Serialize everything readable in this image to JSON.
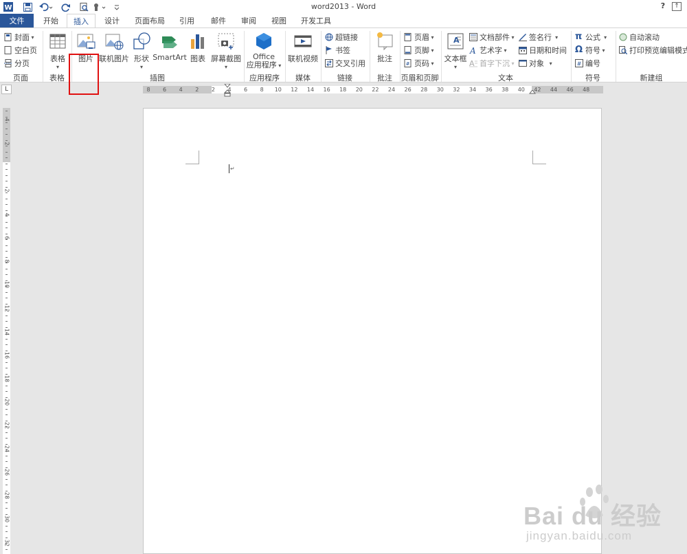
{
  "window": {
    "title": "word2013 - Word"
  },
  "quick_access": {
    "help": "?"
  },
  "tabs": [
    {
      "label": "文件",
      "id": "file"
    },
    {
      "label": "开始",
      "id": "home"
    },
    {
      "label": "插入",
      "id": "insert"
    },
    {
      "label": "设计",
      "id": "design"
    },
    {
      "label": "页面布局",
      "id": "layout"
    },
    {
      "label": "引用",
      "id": "references"
    },
    {
      "label": "邮件",
      "id": "mailings"
    },
    {
      "label": "审阅",
      "id": "review"
    },
    {
      "label": "视图",
      "id": "view"
    },
    {
      "label": "开发工具",
      "id": "developer"
    }
  ],
  "active_tab": "插入",
  "ribbon": {
    "pages": {
      "cover": "封面",
      "blank": "空白页",
      "break": "分页",
      "label": "页面"
    },
    "tables": {
      "table": "表格",
      "label": "表格"
    },
    "illustrations": {
      "picture": "图片",
      "online_picture": "联机图片",
      "shapes": "形状",
      "smartart": "SmartArt",
      "chart": "图表",
      "screenshot": "屏幕截图",
      "label": "插图"
    },
    "apps": {
      "office_line1": "Office",
      "office_line2": "应用程序",
      "label": "应用程序"
    },
    "media": {
      "online_video": "联机视频",
      "label": "媒体"
    },
    "links": {
      "hyperlink": "超链接",
      "bookmark": "书签",
      "cross_ref": "交叉引用",
      "label": "链接"
    },
    "comments": {
      "comment": "批注",
      "label": "批注"
    },
    "header_footer": {
      "header": "页眉",
      "footer": "页脚",
      "page_number": "页码",
      "label": "页眉和页脚"
    },
    "text": {
      "textbox": "文本框",
      "quick_parts": "文档部件",
      "wordart": "艺术字",
      "dropcap": "首字下沉",
      "signature": "签名行",
      "datetime": "日期和时间",
      "object": "对象",
      "label": "文本"
    },
    "symbols": {
      "equation": "公式",
      "symbol": "符号",
      "number": "编号",
      "label": "符号"
    },
    "new_group": {
      "autoscroll": "自动滚动",
      "print_preview": "打印预览编辑模式",
      "label": "新建组"
    }
  },
  "ruler": {
    "corner": "L",
    "h_numbers": [
      "8",
      "6",
      "4",
      "2",
      "2",
      "4",
      "6",
      "8",
      "10",
      "12",
      "14",
      "16",
      "18",
      "20",
      "22",
      "24",
      "26",
      "28",
      "30",
      "32",
      "34",
      "36",
      "38",
      "40",
      "42",
      "44",
      "46",
      "48"
    ],
    "v_numbers": [
      "4",
      "2",
      "2",
      "4",
      "6",
      "8",
      "10",
      "12",
      "14",
      "16",
      "18",
      "20",
      "22",
      "24",
      "26",
      "28",
      "30",
      "32"
    ]
  },
  "watermark": {
    "brand": "Bai du 经验",
    "url": "jingyan.baidu.com"
  },
  "colors": {
    "accent": "#2b579a",
    "highlight": "#e01010"
  }
}
